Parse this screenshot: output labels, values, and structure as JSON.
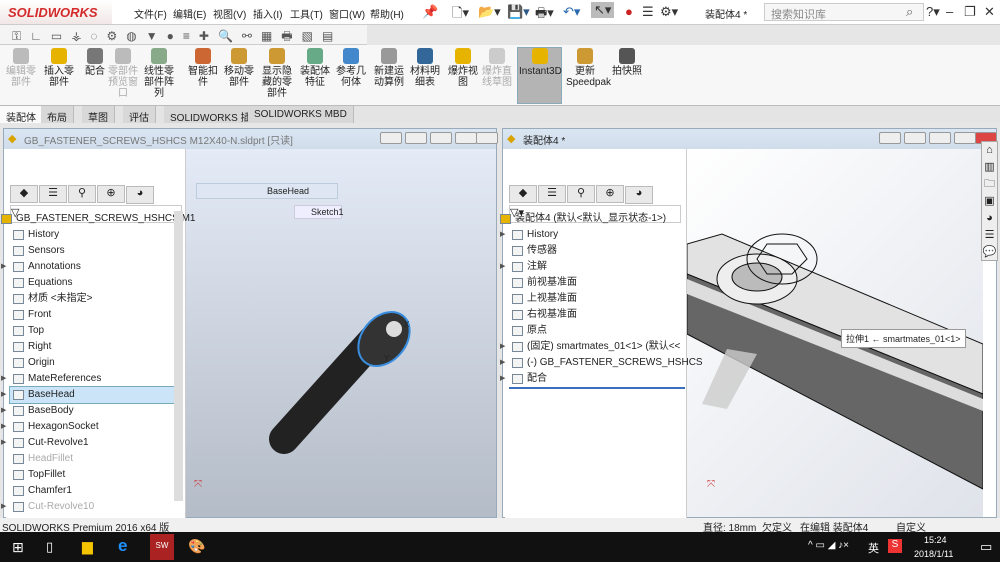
{
  "app": {
    "logo": "SOLIDWORKS",
    "doc_title": "装配体4 *",
    "search_placeholder": "搜索知识库"
  },
  "menu": [
    "文件(F)",
    "编辑(E)",
    "视图(V)",
    "插入(I)",
    "工具(T)",
    "窗口(W)",
    "帮助(H)"
  ],
  "commands": [
    {
      "label": "编辑零部件",
      "disabled": true
    },
    {
      "label": "插入零部件"
    },
    {
      "label": "配合"
    },
    {
      "label": "零部件预览窗口",
      "disabled": true
    },
    {
      "label": "线性零部件阵列"
    },
    {
      "label": "智能扣件"
    },
    {
      "label": "移动零部件"
    },
    {
      "label": "显示隐藏的零部件"
    },
    {
      "label": "装配体特征"
    },
    {
      "label": "参考几何体"
    },
    {
      "label": "新建运动算例"
    },
    {
      "label": "材料明细表"
    },
    {
      "label": "爆炸视图"
    },
    {
      "label": "爆炸直线草图",
      "disabled": true
    },
    {
      "label": "Instant3D"
    },
    {
      "label": "更新Speedpak"
    },
    {
      "label": "拍快照"
    }
  ],
  "tabs": [
    "装配体",
    "布局",
    "草图",
    "评估",
    "SOLIDWORKS 插件",
    "SOLIDWORKS MBD"
  ],
  "left_window": {
    "title": "GB_FASTENER_SCREWS_HSHCS M12X40-N.sldprt [只读]",
    "breadcrumb": "BaseHead",
    "sketch": "Sketch1",
    "tree": [
      {
        "label": "GB_FASTENER_SCREWS_HSHCS M1"
      },
      {
        "label": "History"
      },
      {
        "label": "Sensors"
      },
      {
        "label": "Annotations",
        "exp": true
      },
      {
        "label": "Equations"
      },
      {
        "label": "材质 <未指定>"
      },
      {
        "label": "Front"
      },
      {
        "label": "Top"
      },
      {
        "label": "Right"
      },
      {
        "label": "Origin"
      },
      {
        "label": "MateReferences",
        "exp": true
      },
      {
        "label": "BaseHead",
        "exp": true,
        "selected": true
      },
      {
        "label": "BaseBody",
        "exp": true
      },
      {
        "label": "HexagonSocket",
        "exp": true
      },
      {
        "label": "Cut-Revolve1",
        "exp": true
      },
      {
        "label": "HeadFillet",
        "grey": true
      },
      {
        "label": "TopFillet"
      },
      {
        "label": "Chamfer1"
      },
      {
        "label": "Cut-Revolve10",
        "exp": true,
        "grey": true
      }
    ]
  },
  "right_window": {
    "title": "装配体4 *",
    "tooltip": "拉伸1 ← smartmates_01<1>",
    "tree": [
      {
        "label": "装配体4  (默认<默认_显示状态-1>)"
      },
      {
        "label": "History",
        "exp": true
      },
      {
        "label": "传感器"
      },
      {
        "label": "注解",
        "exp": true
      },
      {
        "label": "前视基准面"
      },
      {
        "label": "上视基准面"
      },
      {
        "label": "右视基准面"
      },
      {
        "label": "原点"
      },
      {
        "label": "(固定) smartmates_01<1> (默认<<",
        "exp": true
      },
      {
        "label": "(-) GB_FASTENER_SCREWS_HSHCS",
        "exp": true
      },
      {
        "label": "配合",
        "exp": true
      }
    ]
  },
  "status": {
    "product": "SOLIDWORKS Premium 2016 x64 版",
    "diameter": "直径: 18mm",
    "state": "欠定义",
    "editing": "在编辑 装配体4",
    "custom": "自定义"
  },
  "taskbar": {
    "time": "15:24",
    "date": "2018/1/11",
    "ime": "英"
  }
}
